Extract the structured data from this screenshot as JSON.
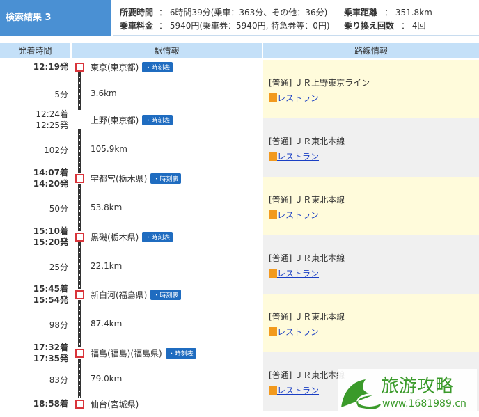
{
  "result": {
    "title": "検索結果 3"
  },
  "summary": {
    "time_label": "所要時間",
    "time_value": "：  6時間39分(乗車：363分、その他：36分)",
    "distance_label": "乗車距離",
    "distance_value": "：  351.8km",
    "fare_label": "乗車料金",
    "fare_value": "：  5940円(乗車券：5940円, 特急券等：0円)",
    "transfers_label": "乗り換え回数",
    "transfers_value": "：  4回"
  },
  "headers": {
    "time": "発着時間",
    "station": "駅情報",
    "route": "路線情報"
  },
  "timetable_label": "・時刻表",
  "stations": [
    {
      "times": [
        "12:19発"
      ],
      "name": "東京(東京都)",
      "bold": true,
      "marker": true,
      "timetable": true
    },
    {
      "times": [
        "12:24着",
        "12:25発"
      ],
      "name": "上野(東京都)",
      "bold": false,
      "marker": false,
      "timetable": true
    },
    {
      "times": [
        "14:07着",
        "14:20発"
      ],
      "name": "宇都宮(栃木県)",
      "bold": true,
      "marker": true,
      "timetable": true
    },
    {
      "times": [
        "15:10着",
        "15:20発"
      ],
      "name": "黒磯(栃木県)",
      "bold": true,
      "marker": true,
      "timetable": true
    },
    {
      "times": [
        "15:45着",
        "15:54発"
      ],
      "name": "新白河(福島県)",
      "bold": true,
      "marker": true,
      "timetable": true
    },
    {
      "times": [
        "17:32着",
        "17:35発"
      ],
      "name": "福島(福島)(福島県)",
      "bold": true,
      "marker": true,
      "timetable": true
    },
    {
      "times": [
        "18:58着"
      ],
      "name": "仙台(宮城県)",
      "bold": true,
      "marker": true,
      "timetable": false
    }
  ],
  "legs": [
    {
      "duration": "5分",
      "distance": "3.6km",
      "route": "[普通] ＪＲ上野東京ライン",
      "link": "レストラン"
    },
    {
      "duration": "102分",
      "distance": "105.9km",
      "route": "[普通] ＪＲ東北本線",
      "link": "レストラン"
    },
    {
      "duration": "50分",
      "distance": "53.8km",
      "route": "[普通] ＪＲ東北本線",
      "link": "レストラン"
    },
    {
      "duration": "25分",
      "distance": "22.1km",
      "route": "[普通] ＪＲ東北本線",
      "link": "レストラン"
    },
    {
      "duration": "98分",
      "distance": "87.4km",
      "route": "[普通] ＪＲ東北本線",
      "link": "レストラン"
    },
    {
      "duration": "83分",
      "distance": "79.0km",
      "route": "[普通] ＪＲ東北本線",
      "link": "レストラン"
    }
  ],
  "colors": {
    "header_blue": "#4a90d3",
    "table_header": "#c4e0f8",
    "route_yellow": "#fffbdb",
    "route_gray": "#f0f0f0",
    "marker_red": "#d9343a",
    "link_blue": "#1a3fc4"
  },
  "watermark": {
    "text": "旅游攻略",
    "url": "www.1681989.cn"
  }
}
